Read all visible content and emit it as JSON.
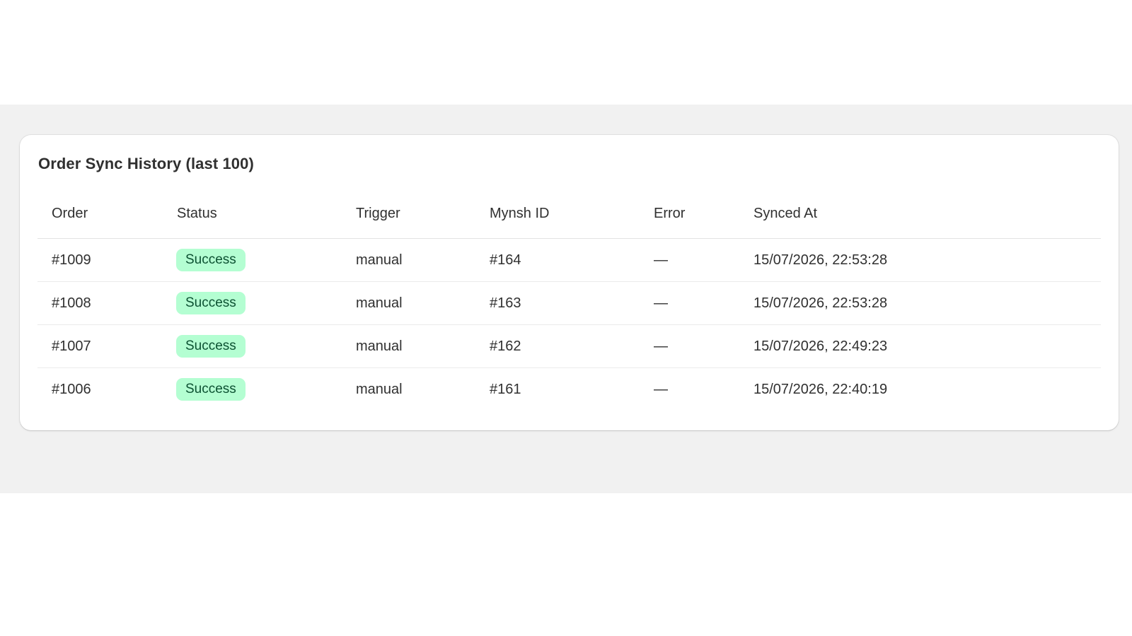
{
  "card": {
    "title": "Order Sync History (last 100)"
  },
  "table": {
    "columns": [
      "Order",
      "Status",
      "Trigger",
      "Mynsh ID",
      "Error",
      "Synced At"
    ],
    "rows": [
      {
        "order": "#1009",
        "status": "Success",
        "trigger": "manual",
        "mynsh_id": "#164",
        "error": "—",
        "synced_at": "15/07/2026, 22:53:28"
      },
      {
        "order": "#1008",
        "status": "Success",
        "trigger": "manual",
        "mynsh_id": "#163",
        "error": "—",
        "synced_at": "15/07/2026, 22:53:28"
      },
      {
        "order": "#1007",
        "status": "Success",
        "trigger": "manual",
        "mynsh_id": "#162",
        "error": "—",
        "synced_at": "15/07/2026, 22:49:23"
      },
      {
        "order": "#1006",
        "status": "Success",
        "trigger": "manual",
        "mynsh_id": "#161",
        "error": "—",
        "synced_at": "15/07/2026, 22:40:19"
      }
    ]
  },
  "colors": {
    "page_band": "#f1f1f1",
    "card_bg": "#ffffff",
    "success_badge_bg": "#b4fed2",
    "success_badge_text": "#0c5132",
    "text": "#303030"
  }
}
